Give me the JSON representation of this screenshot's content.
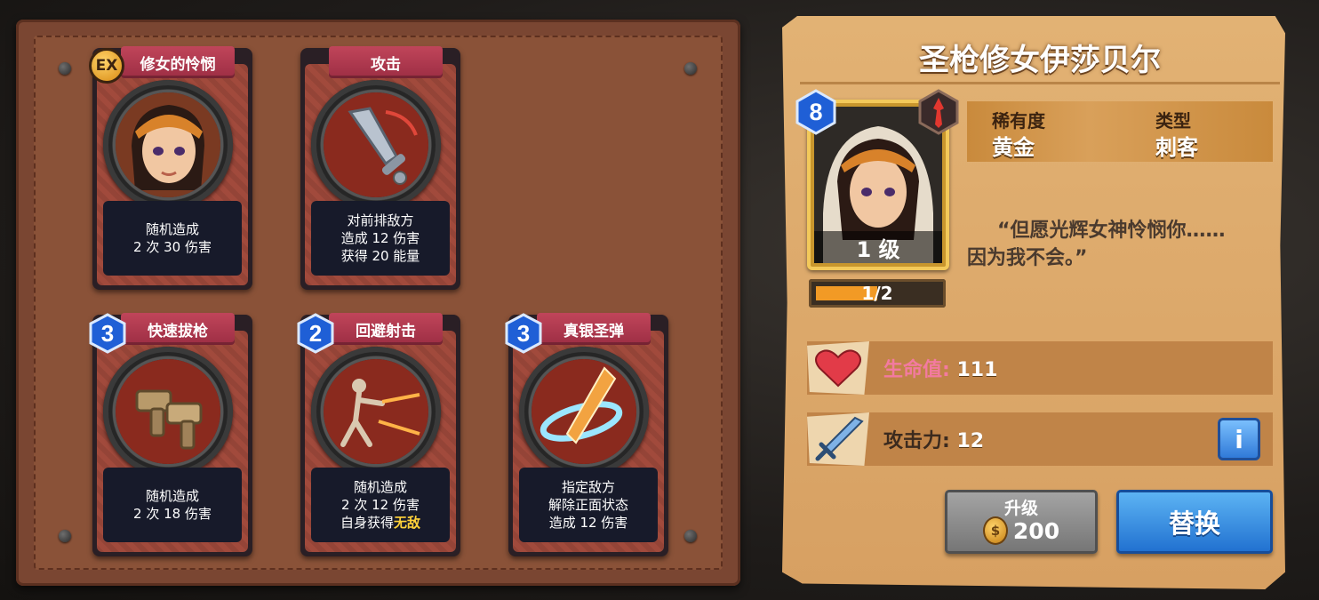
{
  "skills": [
    {
      "title": "修女的怜悯",
      "badge": "EX",
      "lines": [
        "随机造成",
        "2 次 30 伤害"
      ],
      "icon": "nun-portrait-icon"
    },
    {
      "title": "攻击",
      "badge": "",
      "lines": [
        "对前排敌方",
        "造成 12 伤害",
        "获得 20 能量"
      ],
      "icon": "sword-icon"
    },
    {
      "title": "快速拔枪",
      "badge": "3",
      "lines": [
        "随机造成",
        "2 次 18 伤害"
      ],
      "icon": "twin-pistols-icon"
    },
    {
      "title": "回避射击",
      "badge": "2",
      "lines": [
        "随机造成",
        "2 次 12 伤害"
      ],
      "line3_prefix": "自身获得",
      "line3_highlight": "无敌",
      "icon": "dodge-shot-icon"
    },
    {
      "title": "真银圣弹",
      "badge": "3",
      "lines": [
        "指定敌方",
        "解除正面状态",
        "造成 12 伤害"
      ],
      "icon": "silver-bullet-icon"
    }
  ],
  "hero": {
    "name": "圣枪修女伊莎贝尔",
    "star_level": "8",
    "level_text": "1 级",
    "xp_text": "1/2",
    "xp_fraction": 0.5,
    "rarity_label": "稀有度",
    "rarity_value": "黄金",
    "type_label": "类型",
    "type_value": "刺客",
    "quote_line1": "“但愿光辉女神怜悯你……",
    "quote_line2": "因为我不会。”",
    "hp_label": "生命值:",
    "hp_value": "111",
    "atk_label": "攻击力:",
    "atk_value": "12"
  },
  "buttons": {
    "upgrade_label": "升级",
    "upgrade_cost": "200",
    "replace_label": "替换",
    "info_glyph": "i"
  },
  "colors": {
    "card_title": "#b23a50",
    "hp_label": "#f37aa0",
    "highlight": "#ffd23a",
    "replace_button": "#2b86de",
    "upgrade_button": "#8a8a8a"
  }
}
